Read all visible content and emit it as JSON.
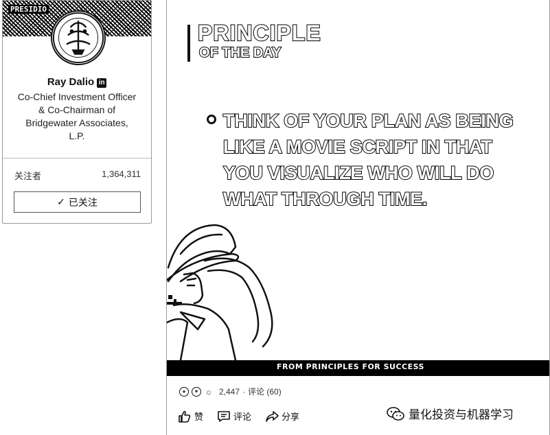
{
  "profile": {
    "banner_text": "PRESIDIO",
    "name": "Ray Dalio",
    "linkedin_badge": "in",
    "title": "Co-Chief Investment Officer & Co-Chairman of Bridgewater Associates, L.P.",
    "followers_label": "关注者",
    "followers_count": "1,364,311",
    "follow_button": "已关注",
    "follow_check": "✓"
  },
  "post": {
    "header_line1": "PRINCIPLE",
    "header_line2": "OF THE DAY",
    "quote": "THINK OF YOUR PLAN AS BEING LIKE A MOVIE SCRIPT IN THAT YOU VISUALIZE WHO WILL DO WHAT THROUGH TIME.",
    "source": "FROM PRINCIPLES FOR SUCCESS",
    "reactions_count": "2,447",
    "separator": "·",
    "comments": "评论 (60)",
    "actions": {
      "like": "赞",
      "comment": "评论",
      "share": "分享"
    }
  },
  "watermark": {
    "text": "量化投资与机器学习"
  },
  "icons": [
    "linkedin-icon",
    "check-icon",
    "like-icon",
    "heart-icon",
    "idea-icon",
    "thumb-up-icon",
    "comment-icon",
    "share-icon",
    "wechat-icon"
  ]
}
